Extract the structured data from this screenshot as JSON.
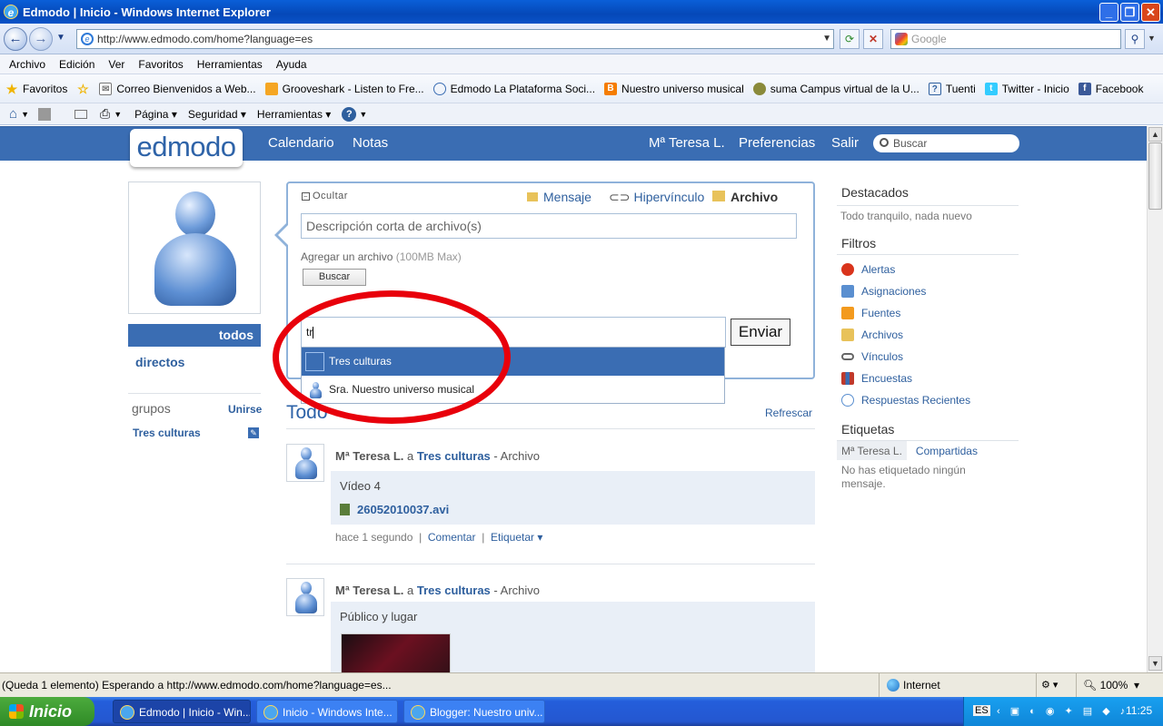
{
  "window": {
    "title": "Edmodo | Inicio - Windows Internet Explorer",
    "minimize": "_",
    "restore": "❐",
    "close": "✕"
  },
  "browser": {
    "url": "http://www.edmodo.com/home?language=es",
    "search_placeholder": "Google",
    "menu": [
      "Archivo",
      "Edición",
      "Ver",
      "Favoritos",
      "Herramientas",
      "Ayuda"
    ],
    "favorites_label": "Favoritos",
    "favorites": [
      {
        "label": "Correo  Bienvenidos a Web...",
        "color": "#ffffff"
      },
      {
        "label": "Grooveshark - Listen to Fre...",
        "color": "#f5a623"
      },
      {
        "label": "Edmodo  La Plataforma Soci...",
        "color": "#3a6db3"
      },
      {
        "label": "Nuestro universo musical",
        "color": "#f57d00"
      },
      {
        "label": "suma Campus virtual de la U...",
        "color": "#8a8a3a"
      },
      {
        "label": "Tuenti",
        "color": "#2e5f9e"
      },
      {
        "label": "Twitter - Inicio",
        "color": "#33ccff"
      },
      {
        "label": "Facebook",
        "color": "#3b5998"
      }
    ],
    "commands": {
      "pagina": "Página",
      "seguridad": "Seguridad",
      "herramientas": "Herramientas",
      "help": "?"
    }
  },
  "edmodo": {
    "logo": "edmodo",
    "nav": {
      "calendario": "Calendario",
      "notas": "Notas",
      "user": "Mª Teresa L.",
      "preferencias": "Preferencias",
      "salir": "Salir"
    },
    "search_placeholder": "Buscar",
    "sidebar": {
      "todos": "todos",
      "directos": "directos",
      "grupos": "grupos",
      "unirse": "Unirse",
      "group_item": "Tres culturas"
    },
    "composer": {
      "ocultar": "Ocultar",
      "mensaje": "Mensaje",
      "hipervinculo": "Hipervínculo",
      "archivo": "Archivo",
      "description_placeholder": "Descripción corta de archivo(s)",
      "add_file": "Agregar un archivo",
      "max": "(100MB Max)",
      "buscar": "Buscar",
      "recipients_value": "tr",
      "enviar": "Enviar",
      "suggestions": [
        "Tres culturas",
        "Sra. Nuestro universo musical"
      ]
    },
    "feed": {
      "title": "Todo",
      "refrescar": "Refrescar",
      "posts": [
        {
          "author": "Mª Teresa L.",
          "connector": "a",
          "group": "Tres culturas",
          "type": "- Archivo",
          "text": "Vídeo 4",
          "file": "26052010037.avi",
          "time": "hace 1 segundo",
          "comentar": "Comentar",
          "etiquetar": "Etiquetar"
        },
        {
          "author": "Mª Teresa L.",
          "connector": "a",
          "group": "Tres culturas",
          "type": "- Archivo",
          "text": "Público y lugar"
        }
      ]
    },
    "right": {
      "destacados": "Destacados",
      "destacados_text": "Todo tranquilo, nada nuevo",
      "filtros": "Filtros",
      "filters": [
        {
          "label": "Alertas",
          "color": "#d9341c"
        },
        {
          "label": "Asignaciones",
          "color": "#5a8fd0"
        },
        {
          "label": "Fuentes",
          "color": "#f39a1e"
        },
        {
          "label": "Archivos",
          "color": "#e8c25a"
        },
        {
          "label": "Vínculos",
          "color": "#666666"
        },
        {
          "label": "Encuestas",
          "color": "#c0392b"
        },
        {
          "label": "Respuestas Recientes",
          "color": "#5a8fd0"
        }
      ],
      "etiquetas": "Etiquetas",
      "tag_tab1": "Mª Teresa L.",
      "tag_tab2": "Compartidas",
      "tags_text": "No has etiquetado ningún mensaje."
    }
  },
  "status": {
    "text": "(Queda 1 elemento) Esperando a http://www.edmodo.com/home?language=es...",
    "zone": "Internet",
    "zoom": "100%"
  },
  "taskbar": {
    "start": "Inicio",
    "tasks": [
      "Edmodo | Inicio - Win...",
      "Inicio - Windows Inte...",
      "Blogger: Nuestro univ..."
    ],
    "lang": "ES",
    "time": "11:25"
  }
}
